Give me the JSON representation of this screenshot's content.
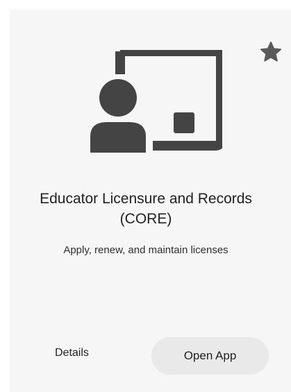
{
  "card": {
    "title": "Educator Licensure and Records (CORE)",
    "description": "Apply, renew, and maintain licenses",
    "details_label": "Details",
    "open_label": "Open App",
    "icon": "teacher-at-board-icon",
    "favorite_icon": "star-icon"
  },
  "colors": {
    "card_background": "#f6f6f6",
    "icon": "#444444",
    "star": "#5a5a5a",
    "button_background": "#e9e9e9",
    "text": "#222222"
  }
}
